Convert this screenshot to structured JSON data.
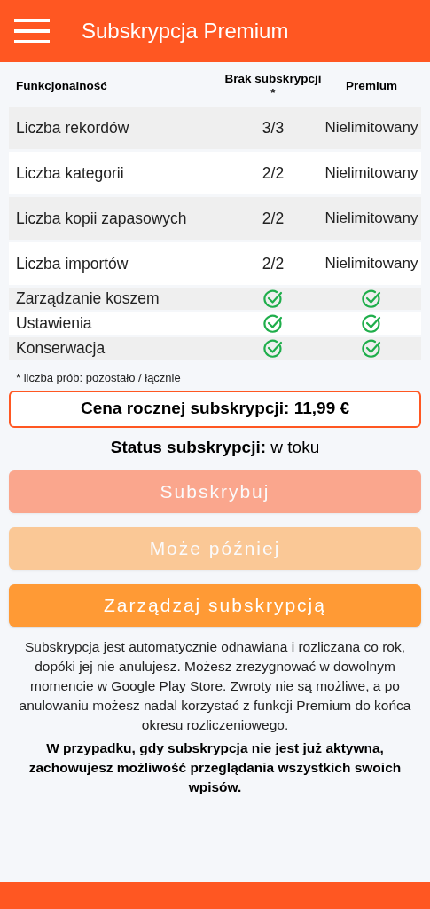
{
  "app_bar": {
    "title": "Subskrypcja Premium"
  },
  "table": {
    "columns": [
      "Funkcjonalność",
      "Brak subskrypcji *",
      "Premium"
    ],
    "rows": [
      {
        "kind": "text",
        "feature": "Liczba rekordów",
        "free": "3/3",
        "premium": "Nielimitowany"
      },
      {
        "kind": "text",
        "feature": "Liczba kategorii",
        "free": "2/2",
        "premium": "Nielimitowany"
      },
      {
        "kind": "text",
        "feature": "Liczba kopii zapasowych",
        "free": "2/2",
        "premium": "Nielimitowany"
      },
      {
        "kind": "text",
        "feature": "Liczba importów",
        "free": "2/2",
        "premium": "Nielimitowany"
      },
      {
        "kind": "check",
        "feature": "Zarządzanie koszem",
        "free_checked": true,
        "premium_checked": true
      },
      {
        "kind": "check",
        "feature": "Ustawienia",
        "free_checked": true,
        "premium_checked": true
      },
      {
        "kind": "check",
        "feature": "Konserwacja",
        "free_checked": true,
        "premium_checked": true
      }
    ]
  },
  "footnote": "* liczba prób: pozostało / łącznie",
  "price": "Cena rocznej subskrypcji: 11,99 €",
  "status": "**Status subskrypcji:** w toku",
  "buttons": [
    {
      "kind": "primary",
      "label": "Subskrybuj",
      "disabled": true
    },
    {
      "kind": "secondary",
      "label": "Może później",
      "disabled": true
    },
    {
      "kind": "secondary",
      "label": "Zarządzaj subskrypcją",
      "disabled": false
    }
  ],
  "info": "Subskrypcja jest automatycznie odnawiana i rozliczana co rok, dopóki jej nie anulujesz. Możesz zrezygnować w dowolnym momencie w Google Play Store. Zwroty nie są możliwe, a po anulowaniu możesz nadal korzystać z funkcji Premium do końca okresu rozliczeniowego.",
  "note": "W przypadku, gdy subskrypcja nie jest już aktywna, zachowujesz możliwość przeglądania wszystkich swoich wpisów."
}
